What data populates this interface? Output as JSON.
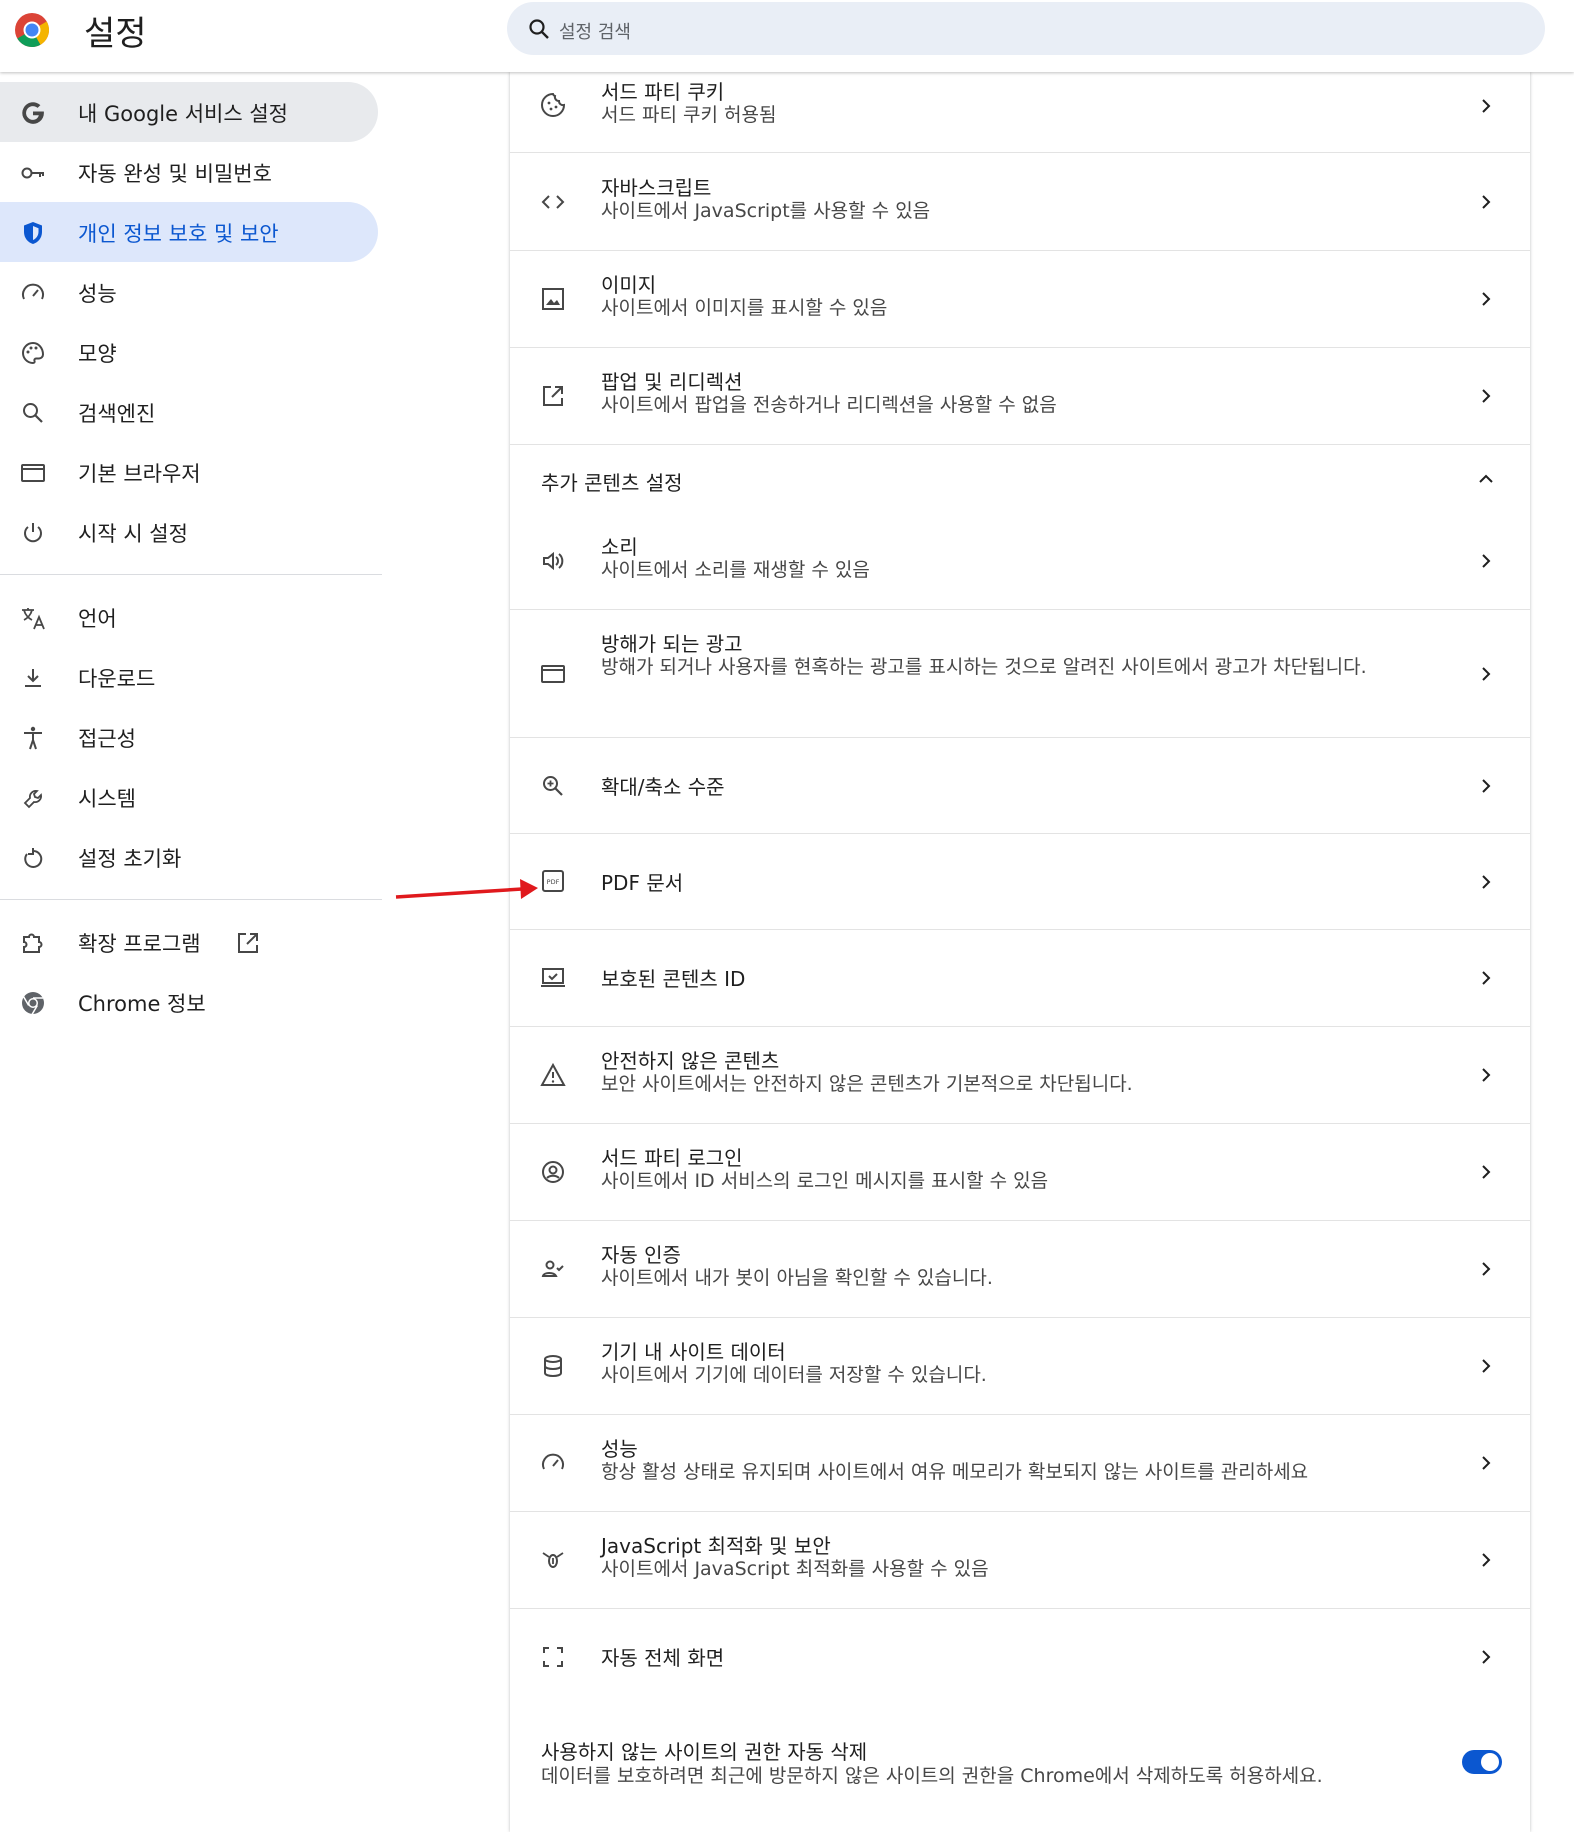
{
  "app": {
    "title": "설정"
  },
  "search": {
    "placeholder": "설정 검색"
  },
  "sidebar": {
    "items": [
      {
        "label": "내 Google 서비스 설정",
        "icon": "google-g-icon"
      },
      {
        "label": "자동 완성 및 비밀번호",
        "icon": "key-icon"
      },
      {
        "label": "개인 정보 보호 및 보안",
        "icon": "shield-icon"
      },
      {
        "label": "성능",
        "icon": "speedometer-icon"
      },
      {
        "label": "모양",
        "icon": "palette-icon"
      },
      {
        "label": "검색엔진",
        "icon": "search-icon"
      },
      {
        "label": "기본 브라우저",
        "icon": "browser-window-icon"
      },
      {
        "label": "시작 시 설정",
        "icon": "power-icon"
      },
      {
        "label": "언어",
        "icon": "translate-icon"
      },
      {
        "label": "다운로드",
        "icon": "download-icon"
      },
      {
        "label": "접근성",
        "icon": "accessibility-icon"
      },
      {
        "label": "시스템",
        "icon": "wrench-icon"
      },
      {
        "label": "설정 초기화",
        "icon": "reset-icon"
      },
      {
        "label": "확장 프로그램",
        "icon": "puzzle-icon"
      },
      {
        "label": "Chrome 정보",
        "icon": "chrome-icon"
      }
    ]
  },
  "main": {
    "rows_top": [
      {
        "title": "서드 파티 쿠키",
        "subtitle": "서드 파티 쿠키 허용됨",
        "icon": "cookie-icon"
      },
      {
        "title": "자바스크립트",
        "subtitle": "사이트에서 JavaScript를 사용할 수 있음",
        "icon": "code-icon"
      },
      {
        "title": "이미지",
        "subtitle": "사이트에서 이미지를 표시할 수 있음",
        "icon": "image-icon"
      },
      {
        "title": "팝업 및 리디렉션",
        "subtitle": "사이트에서 팝업을 전송하거나 리디렉션을 사용할 수 없음",
        "icon": "open-in-new-icon"
      }
    ],
    "section_title": "추가 콘텐츠 설정",
    "rows": [
      {
        "title": "소리",
        "subtitle": "사이트에서 소리를 재생할 수 있음",
        "icon": "volume-icon"
      },
      {
        "title": "방해가 되는 광고",
        "subtitle": "방해가 되거나 사용자를 현혹하는 광고를 표시하는 것으로 알려진 사이트에서 광고가 차단됩니다.",
        "icon": "ad-window-icon"
      },
      {
        "title": "확대/축소 수준",
        "subtitle": "",
        "icon": "zoom-in-icon"
      },
      {
        "title": "PDF 문서",
        "subtitle": "",
        "icon": "pdf-icon"
      },
      {
        "title": "보호된 콘텐츠 ID",
        "subtitle": "",
        "icon": "protected-content-icon"
      },
      {
        "title": "안전하지 않은 콘텐츠",
        "subtitle": "보안 사이트에서는 안전하지 않은 콘텐츠가 기본적으로 차단됩니다.",
        "icon": "warning-icon"
      },
      {
        "title": "서드 파티 로그인",
        "subtitle": "사이트에서 ID 서비스의 로그인 메시지를 표시할 수 있음",
        "icon": "account-circle-icon"
      },
      {
        "title": "자동 인증",
        "subtitle": "사이트에서 내가 봇이 아님을 확인할 수 있습니다.",
        "icon": "person-check-icon"
      },
      {
        "title": "기기 내 사이트 데이터",
        "subtitle": "사이트에서 기기에 데이터를 저장할 수 있습니다.",
        "icon": "database-icon"
      },
      {
        "title": "성능",
        "subtitle": "항상 활성 상태로 유지되며 사이트에서 여유 메모리가 확보되지 않는 사이트를 관리하세요",
        "icon": "speedometer-icon"
      },
      {
        "title": "JavaScript 최적화 및 보안",
        "subtitle": "사이트에서 JavaScript 최적화를 사용할 수 있음",
        "icon": "bug-icon"
      },
      {
        "title": "자동 전체 화면",
        "subtitle": "",
        "icon": "fullscreen-icon"
      }
    ],
    "auto_revoke": {
      "title": "사용하지 않는 사이트의 권한 자동 삭제",
      "subtitle": "데이터를 보호하려면 최근에 방문하지 않은 사이트의 권한을 Chrome에서 삭제하도록 허용하세요.",
      "toggle_on": true
    }
  },
  "colors": {
    "accent": "#0b57d0",
    "active_bg": "#dde7fb",
    "annotation_arrow": "#e0191d"
  }
}
